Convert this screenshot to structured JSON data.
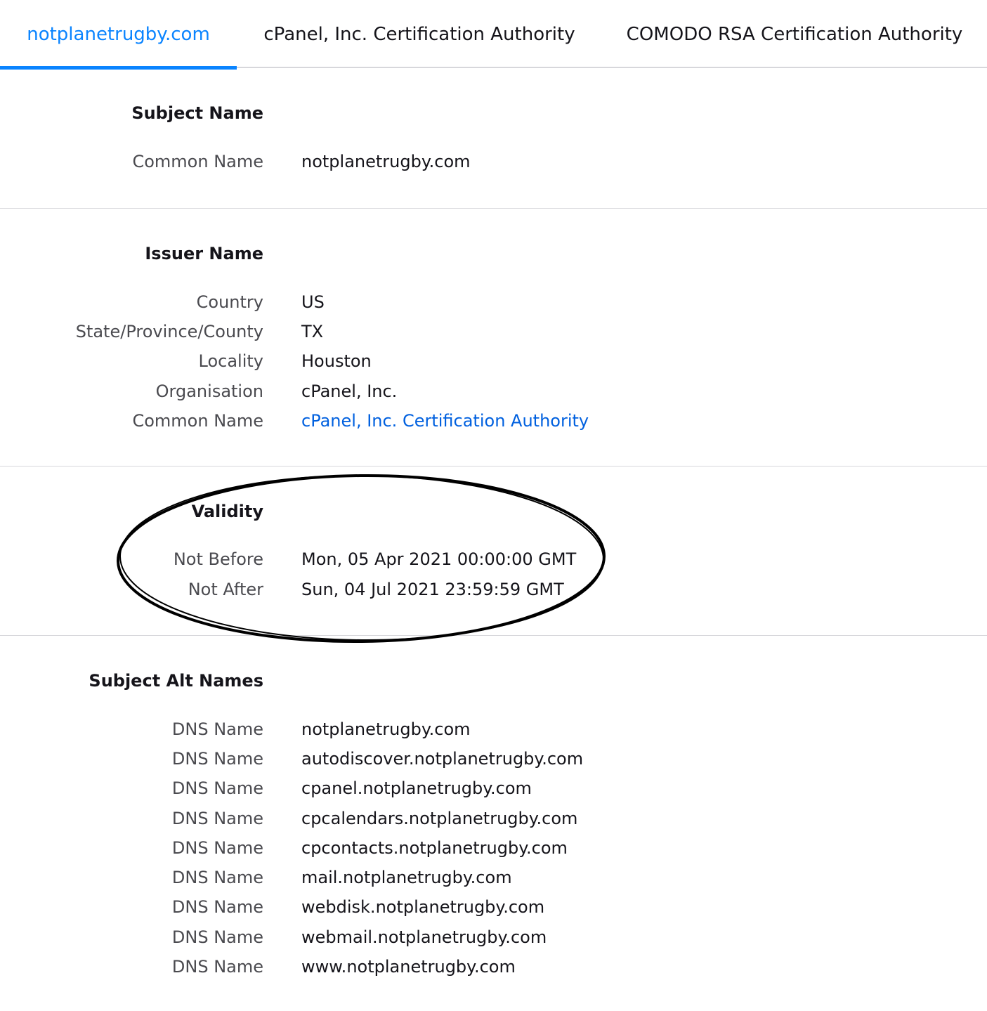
{
  "tabs": [
    {
      "label": "notplanetrugby.com",
      "selected": true
    },
    {
      "label": "cPanel, Inc. Certification Authority",
      "selected": false
    },
    {
      "label": "COMODO RSA Certification Authority",
      "selected": false
    }
  ],
  "subject_name": {
    "title": "Subject Name",
    "rows": [
      {
        "label": "Common Name",
        "value": "notplanetrugby.com"
      }
    ]
  },
  "issuer_name": {
    "title": "Issuer Name",
    "rows": [
      {
        "label": "Country",
        "value": "US"
      },
      {
        "label": "State/Province/County",
        "value": "TX"
      },
      {
        "label": "Locality",
        "value": "Houston"
      },
      {
        "label": "Organisation",
        "value": "cPanel, Inc."
      },
      {
        "label": "Common Name",
        "value": "cPanel, Inc. Certification Authority"
      }
    ]
  },
  "validity": {
    "title": "Validity",
    "rows": [
      {
        "label": "Not Before",
        "value": "Mon, 05 Apr 2021 00:00:00 GMT"
      },
      {
        "label": "Not After",
        "value": "Sun, 04 Jul 2021 23:59:59 GMT"
      }
    ]
  },
  "subject_alt_names": {
    "title": "Subject Alt Names",
    "rows": [
      {
        "label": "DNS Name",
        "value": "notplanetrugby.com"
      },
      {
        "label": "DNS Name",
        "value": "autodiscover.notplanetrugby.com"
      },
      {
        "label": "DNS Name",
        "value": "cpanel.notplanetrugby.com"
      },
      {
        "label": "DNS Name",
        "value": "cpcalendars.notplanetrugby.com"
      },
      {
        "label": "DNS Name",
        "value": "cpcontacts.notplanetrugby.com"
      },
      {
        "label": "DNS Name",
        "value": "mail.notplanetrugby.com"
      },
      {
        "label": "DNS Name",
        "value": "webdisk.notplanetrugby.com"
      },
      {
        "label": "DNS Name",
        "value": "webmail.notplanetrugby.com"
      },
      {
        "label": "DNS Name",
        "value": "www.notplanetrugby.com"
      }
    ]
  },
  "colors": {
    "accent": "#0a84ff",
    "link": "#0060df",
    "text": "#15141a",
    "label": "#4a4a4f",
    "divider": "#d7d7db"
  }
}
